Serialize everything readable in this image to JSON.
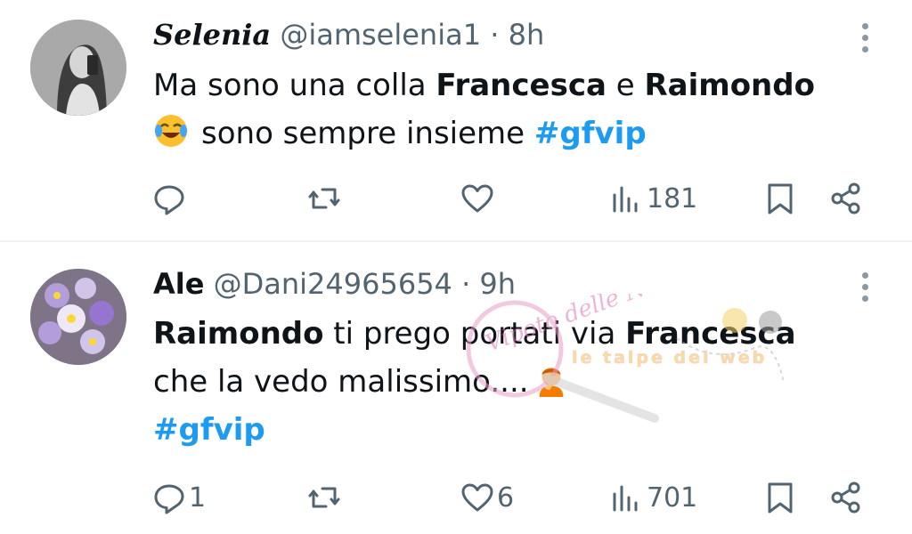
{
  "tweets": [
    {
      "name": "Selenia",
      "handle": "@iamselenia1",
      "separator": "·",
      "time": "8h",
      "text": {
        "line1_prefix": "Ma sono una colla ",
        "bold1": "Francesca",
        "mid": " e ",
        "bold2": "Raimondo",
        "line2_text": "sono sempre insieme  ",
        "hashtag": "#gfvip"
      },
      "emoji_icon": "face-with-tears-of-joy-icon",
      "metrics": {
        "replies": "",
        "retweets": "",
        "likes": "",
        "views": "181"
      }
    },
    {
      "name": "Ale",
      "handle": "@Dani24965654",
      "separator": "·",
      "time": "9h",
      "text": {
        "bold1": "Raimondo",
        "line1_mid": " ti prego portati via ",
        "bold2": "Francesca",
        "line2_text": "che la vedo malissimo....",
        "hashtag": "#gfvip"
      },
      "emoji_icon": "person-facepalming-icon",
      "metrics": {
        "replies": "1",
        "retweets": "",
        "likes": "6",
        "views": "701"
      }
    }
  ],
  "watermark": {
    "brand": "Vipoto delle News",
    "sub": "le talpe del web"
  },
  "colors": {
    "hashtag": "#1d9bf0",
    "muted": "#536471",
    "divider": "#eff3f4"
  }
}
